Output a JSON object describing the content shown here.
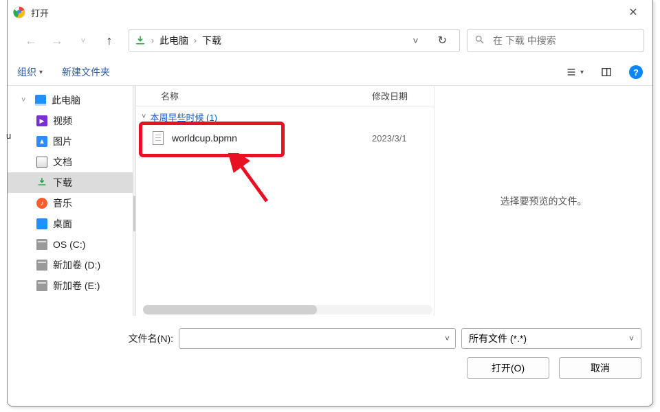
{
  "titlebar": {
    "title": "打开"
  },
  "nav": {
    "crumb1": "此电脑",
    "crumb2": "下载",
    "search_placeholder": "在 下载 中搜索"
  },
  "toolbar": {
    "organize": "组织",
    "new_folder": "新建文件夹"
  },
  "sidebar": {
    "root": "此电脑",
    "items": [
      {
        "label": "视频"
      },
      {
        "label": "图片"
      },
      {
        "label": "文档"
      },
      {
        "label": "下载"
      },
      {
        "label": "音乐"
      },
      {
        "label": "桌面"
      },
      {
        "label": "OS (C:)"
      },
      {
        "label": "新加卷 (D:)"
      },
      {
        "label": "新加卷 (E:)"
      }
    ]
  },
  "filelist": {
    "col_name": "名称",
    "col_date": "修改日期",
    "group_label": "本周早些时候 (1)",
    "files": [
      {
        "name": "worldcup.bpmn",
        "date": "2023/3/1"
      }
    ]
  },
  "preview": {
    "message": "选择要预览的文件。"
  },
  "bottom": {
    "filename_label": "文件名(N):",
    "filename_value": "",
    "filter_label": "所有文件 (*.*)",
    "open_label": "打开(O)",
    "cancel_label": "取消"
  }
}
